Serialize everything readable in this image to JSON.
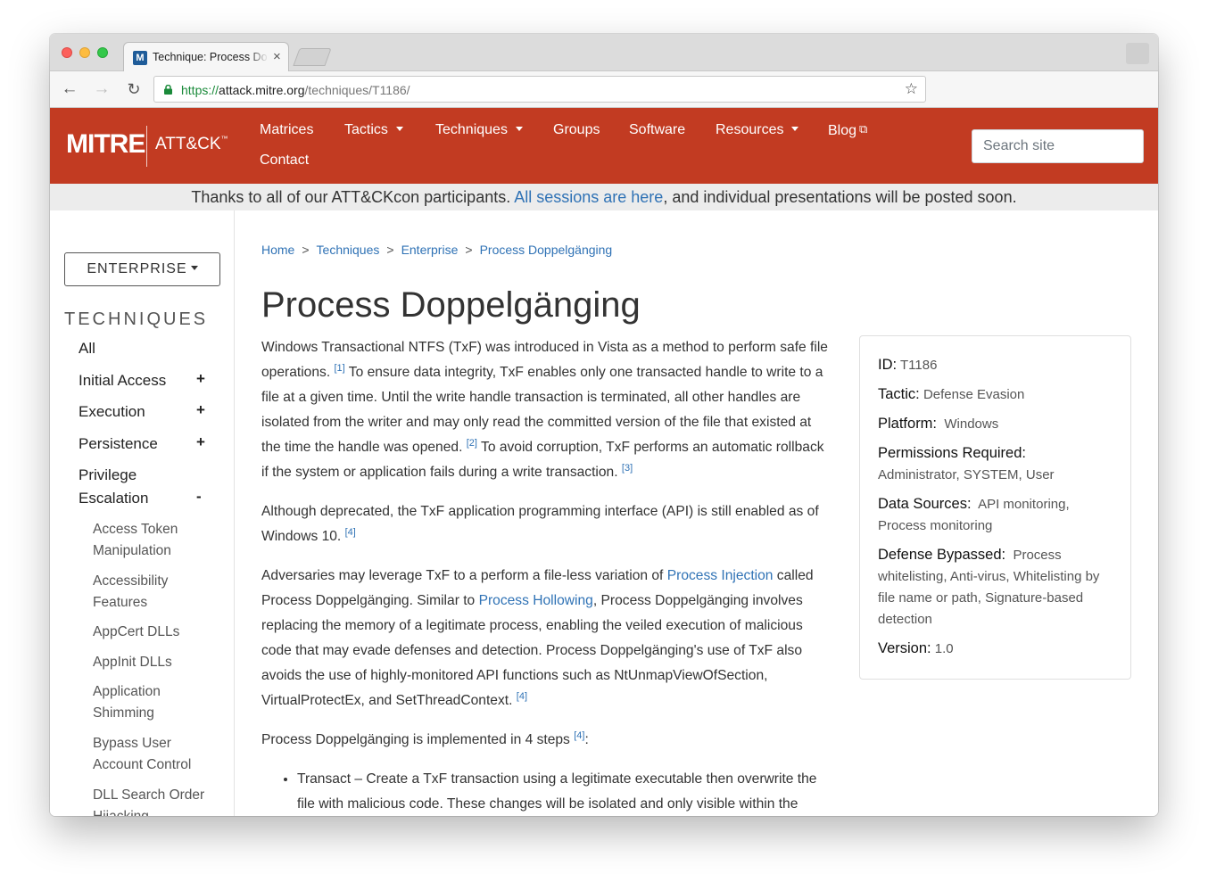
{
  "browser": {
    "tab_title": "Technique: Process Do",
    "tab_favicon": "M",
    "tab_close": "×",
    "url_scheme": "https://",
    "url_host": "attack.mitre.org",
    "url_path": "/techniques/T1186/"
  },
  "header": {
    "logo_mitre": "MITRE",
    "logo_attack": "ATT&CK",
    "logo_tm": "™",
    "nav": [
      "Matrices",
      "Tactics",
      "Techniques",
      "Groups",
      "Software",
      "Resources",
      "Blog",
      "Contact"
    ],
    "search_placeholder": "Search site"
  },
  "banner": {
    "text_before": "Thanks to all of our ATT&CKcon participants. ",
    "link": "All sessions are here",
    "text_after": ", and individual presentations will be posted soon."
  },
  "sidebar": {
    "domain_button": "ENTERPRISE",
    "heading": "TECHNIQUES",
    "items": [
      {
        "label": "All",
        "toggle": ""
      },
      {
        "label": "Initial Access",
        "toggle": "+"
      },
      {
        "label": "Execution",
        "toggle": "+"
      },
      {
        "label": "Persistence",
        "toggle": "+"
      },
      {
        "label": "Privilege Escalation",
        "toggle": "-"
      }
    ],
    "subitems": [
      "Access Token Manipulation",
      "Accessibility Features",
      "AppCert DLLs",
      "AppInit DLLs",
      "Application Shimming",
      "Bypass User Account Control",
      "DLL Search Order Hijacking"
    ]
  },
  "breadcrumb": [
    "Home",
    "Techniques",
    "Enterprise",
    "Process Doppelgänging"
  ],
  "breadcrumb_sep": ">",
  "title": "Process Doppelgänging",
  "description": {
    "p1": {
      "a": "Windows Transactional NTFS (TxF) was introduced in Vista as a method to perform safe file operations. ",
      "ref1": "[1]",
      "b": " To ensure data integrity, TxF enables only one transacted handle to write to a file at a given time. Until the write handle transaction is terminated, all other handles are isolated from the writer and may only read the committed version of the file that existed at the time the handle was opened. ",
      "ref2": "[2]",
      "c": " To avoid corruption, TxF performs an automatic rollback if the system or application fails during a write transaction. ",
      "ref3": "[3]"
    },
    "p2": {
      "a": "Although deprecated, the TxF application programming interface (API) is still enabled as of Windows 10. ",
      "ref": "[4]"
    },
    "p3": {
      "a": "Adversaries may leverage TxF to a perform a file-less variation of ",
      "link1": "Process Injection",
      "b": " called Process Doppelgänging. Similar to ",
      "link2": "Process Hollowing",
      "c": ", Process Doppelgänging involves replacing the memory of a legitimate process, enabling the veiled execution of malicious code that may evade defenses and detection. Process Doppelgänging's use of TxF also avoids the use of highly-monitored API functions such as NtUnmapViewOfSection, VirtualProtectEx, and SetThreadContext. ",
      "ref": "[4]"
    },
    "p4": {
      "a": "Process Doppelgänging is implemented in 4 steps ",
      "ref": "[4]",
      "b": ":"
    },
    "steps": [
      "Transact – Create a TxF transaction using a legitimate executable then overwrite the file with malicious code. These changes will be isolated and only visible within the context of the transaction."
    ]
  },
  "card": {
    "id_label": "ID:",
    "id": "T1186",
    "tactic_label": "Tactic:",
    "tactic": "Defense Evasion",
    "platform_label": "Platform:",
    "platform": "Windows",
    "perm_label": "Permissions Required:",
    "perm": "Administrator, SYSTEM, User",
    "ds_label": "Data Sources:",
    "ds": "API monitoring, Process monitoring",
    "db_label": "Defense Bypassed:",
    "db": "Process whitelisting, Anti-virus, Whitelisting by file name or path, Signature-based detection",
    "version_label": "Version:",
    "version": "1.0"
  },
  "colors": {
    "header_red": "#c23b22",
    "link_blue": "#2f72b5",
    "banner_gray": "#ececec"
  },
  "icons": [
    "close-icon",
    "back-arrow-icon",
    "forward-arrow-icon",
    "reload-icon",
    "lock-icon",
    "star-icon",
    "external-link-icon",
    "caret-down-icon"
  ]
}
